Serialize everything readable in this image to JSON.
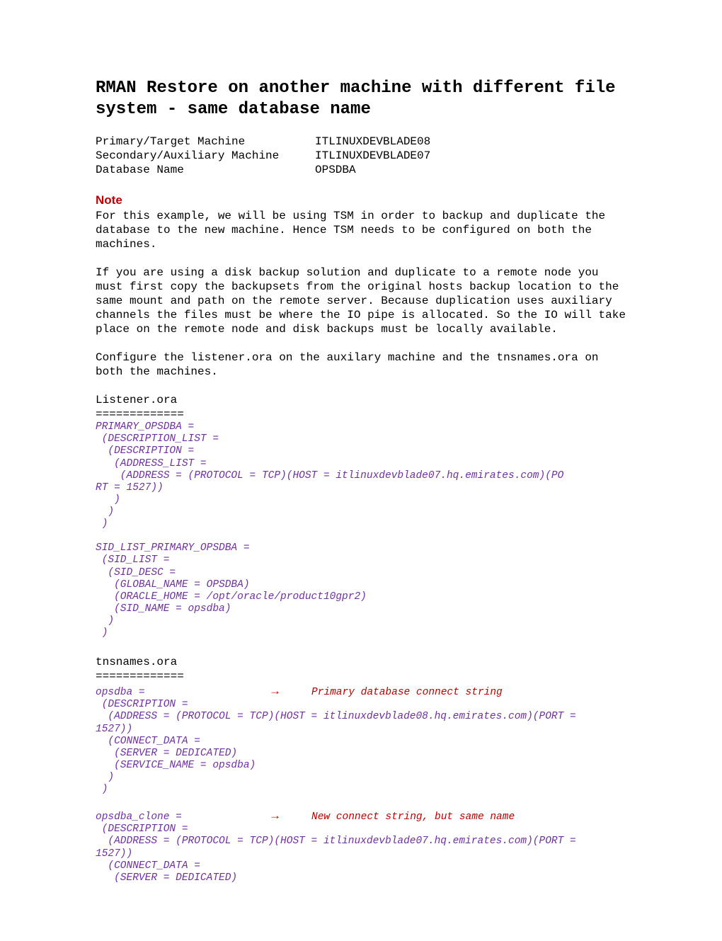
{
  "title": "RMAN Restore on another machine with different file system - same database name",
  "info": {
    "primary_label": "Primary/Target Machine",
    "primary_value": "ITLINUXDEVBLADE08",
    "secondary_label": "Secondary/Auxiliary Machine",
    "secondary_value": "ITLINUXDEVBLADE07",
    "dbname_label": "Database Name",
    "dbname_value": "OPSDBA"
  },
  "note_heading": "Note",
  "paragraphs": {
    "p1": "For this example, we will be using TSM in order to backup and duplicate the database to the new machine. Hence TSM needs to be configured on both the machines.",
    "p2": "If you are using a disk backup solution and duplicate to a remote node you must first copy the backupsets from the original hosts backup location to the same mount and path on the remote server. Because duplication uses auxiliary channels the files must be where the IO pipe is allocated. So the IO will take place on the remote node and disk backups must be locally available.",
    "p3": "Configure the listener.ora on the auxilary machine and the tnsnames.ora on both the machines."
  },
  "listener": {
    "name": "Listener.ora",
    "divider": "=============",
    "code": "PRIMARY_OPSDBA =\n (DESCRIPTION_LIST =\n  (DESCRIPTION =\n   (ADDRESS_LIST =\n    (ADDRESS = (PROTOCOL = TCP)(HOST = itlinuxdevblade07.hq.emirates.com)(PO\nRT = 1527))\n   )\n  )\n )\n\nSID_LIST_PRIMARY_OPSDBA =\n (SID_LIST =\n  (SID_DESC =\n   (GLOBAL_NAME = OPSDBA)\n   (ORACLE_HOME = /opt/oracle/product10gpr2)\n   (SID_NAME = opsdba)\n  )\n )"
  },
  "tnsnames": {
    "name": "tnsnames.ora",
    "divider": "=============",
    "entry1_key": "opsdba =",
    "entry1_arrow": "→",
    "entry1_comment": "Primary database connect string",
    "entry1_code": " (DESCRIPTION =\n  (ADDRESS = (PROTOCOL = TCP)(HOST = itlinuxdevblade08.hq.emirates.com)(PORT =\n1527))\n  (CONNECT_DATA =\n   (SERVER = DEDICATED)\n   (SERVICE_NAME = opsdba)\n  )\n )",
    "entry2_key": "opsdba_clone =",
    "entry2_arrow": "→",
    "entry2_comment": "New connect string, but same name",
    "entry2_code": " (DESCRIPTION =\n  (ADDRESS = (PROTOCOL = TCP)(HOST = itlinuxdevblade07.hq.emirates.com)(PORT =\n1527))\n  (CONNECT_DATA =\n   (SERVER = DEDICATED)"
  }
}
